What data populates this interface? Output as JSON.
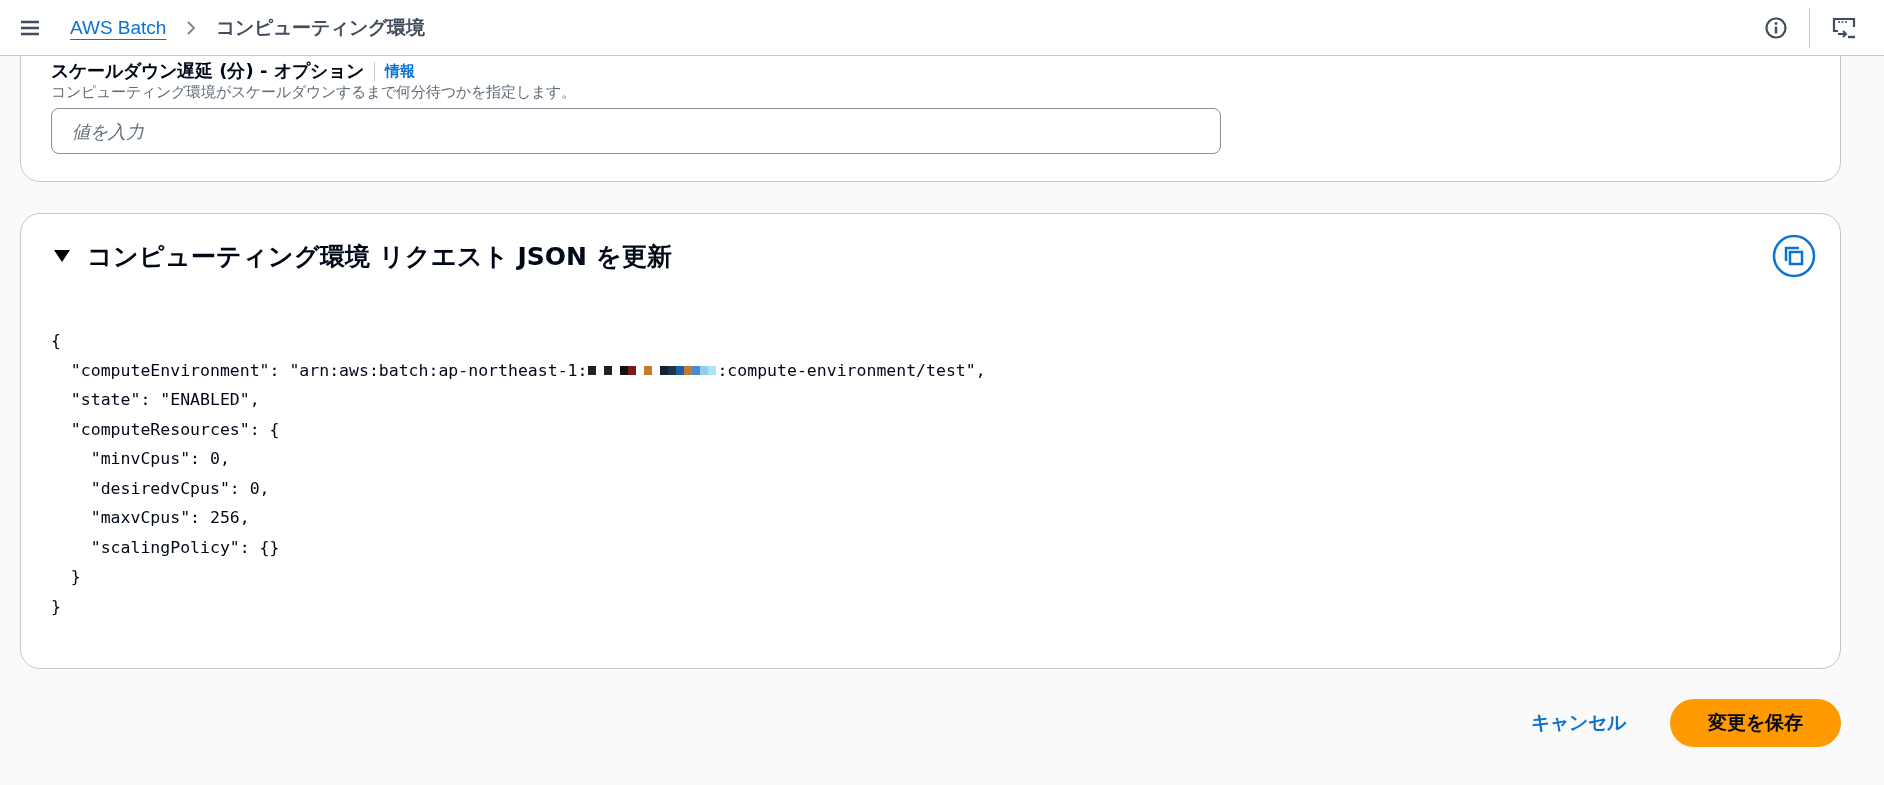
{
  "header": {
    "breadcrumbs": [
      {
        "label": "AWS Batch",
        "kind": "link"
      },
      {
        "label": "コンピューティング環境",
        "kind": "current"
      }
    ]
  },
  "scale_down_field": {
    "label": "スケールダウン遅延 (分) - オプション",
    "info_link": "情報",
    "description": "コンピューティング環境がスケールダウンするまで何分待つかを指定します。",
    "placeholder": "値を入力"
  },
  "json_section": {
    "title": "コンピューティング環境 リクエスト JSON を更新",
    "expanded": true,
    "code_lines": [
      {
        "text": "{"
      },
      {
        "text": "  \"computeEnvironment\": \"arn:aws:batch:ap-northeast-1:",
        "redacted": true,
        "after": ":compute-environment/test\","
      },
      {
        "text": "  \"state\": \"ENABLED\","
      },
      {
        "text": "  \"computeResources\": {"
      },
      {
        "text": "    \"minvCpus\": 0,"
      },
      {
        "text": "    \"desiredvCpus\": 0,"
      },
      {
        "text": "    \"maxvCpus\": 256,"
      },
      {
        "text": "    \"scalingPolicy\": {}"
      },
      {
        "text": "  }"
      },
      {
        "text": "}"
      }
    ]
  },
  "actions": [
    {
      "label": "キャンセル",
      "kind": "link"
    },
    {
      "label": "変更を保存",
      "kind": "primary"
    }
  ]
}
